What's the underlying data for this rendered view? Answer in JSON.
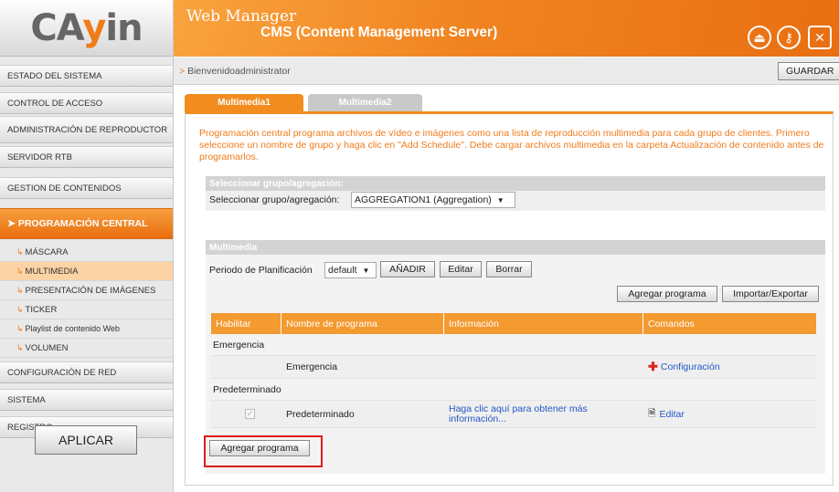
{
  "logo": {
    "text_pre": "CA",
    "text_o": "y",
    "text_post": "in"
  },
  "sidebar": {
    "items": [
      {
        "label": "ESTADO DEL SISTEMA"
      },
      {
        "label": "CONTROL DE ACCESO"
      },
      {
        "label": "ADMINISTRACIÓN DE REPRODUCTOR"
      },
      {
        "label": "SERVIDOR RTB"
      },
      {
        "label": "GESTION DE CONTENIDOS"
      },
      {
        "label": "PROGRAMACIÓN CENTRAL"
      }
    ],
    "subitems": [
      {
        "label": "MÁSCARA"
      },
      {
        "label": "MULTIMEDIA"
      },
      {
        "label": "PRESENTACIÓN DE IMÁGENES"
      },
      {
        "label": "TICKER"
      },
      {
        "label": "Playlist de contenido Web"
      },
      {
        "label": "VOLUMEN"
      }
    ],
    "items_after": [
      {
        "label": "CONFIGURACIÓN DE RED"
      },
      {
        "label": "SISTEMA"
      },
      {
        "label": "REGISTRO"
      }
    ],
    "apply_label": "APLICAR"
  },
  "header": {
    "title1": "Web Manager",
    "title2": "CMS (Content Management Server)"
  },
  "breadcrumb": {
    "marker": ">",
    "text": "Bienvenidoadministrator",
    "save_label": "GUARDAR"
  },
  "tabs": [
    {
      "label": "Multimedia1"
    },
    {
      "label": "Multimedia2"
    }
  ],
  "description": "Programación central programa archivos de vídeo e imágenes como una lista de reproducción multimedia para cada grupo de clientes. Primero seleccione un nombre de grupo y haga clic en \"Add Schedule\". Debe cargar archivos multimedia en la carpeta Actualización de contenido antes de programarlos.",
  "group_section": {
    "header": "Seleccionar grupo/agregación:",
    "label": "Seleccionar grupo/agregación:",
    "selected": "AGGREGATION1 (Aggregation)"
  },
  "multimedia_section": {
    "header": "Multimedia",
    "period_label": "Periodo de Planificación",
    "period_selected": "default",
    "add_label": "AÑADIR",
    "edit_label": "Editar",
    "delete_label": "Borrar",
    "add_program_label": "Agregar programa",
    "import_export_label": "Importar/Exportar",
    "bottom_add_program_label": "Agregar programa"
  },
  "table": {
    "headers": [
      "Habilitar",
      "Nombre de programa",
      "Información",
      "Comandos"
    ],
    "group1": "Emergencia",
    "row1": {
      "name": "Emergencia",
      "info": "",
      "command": "Configuración"
    },
    "group2": "Predeterminado",
    "row2": {
      "name": "Predeterminado",
      "info": "Haga clic aquí para obtener más información...",
      "command": "Editar"
    }
  },
  "colors": {
    "accent": "#f28c1f",
    "link": "#2457c5",
    "highlight": "#e11b1b"
  }
}
